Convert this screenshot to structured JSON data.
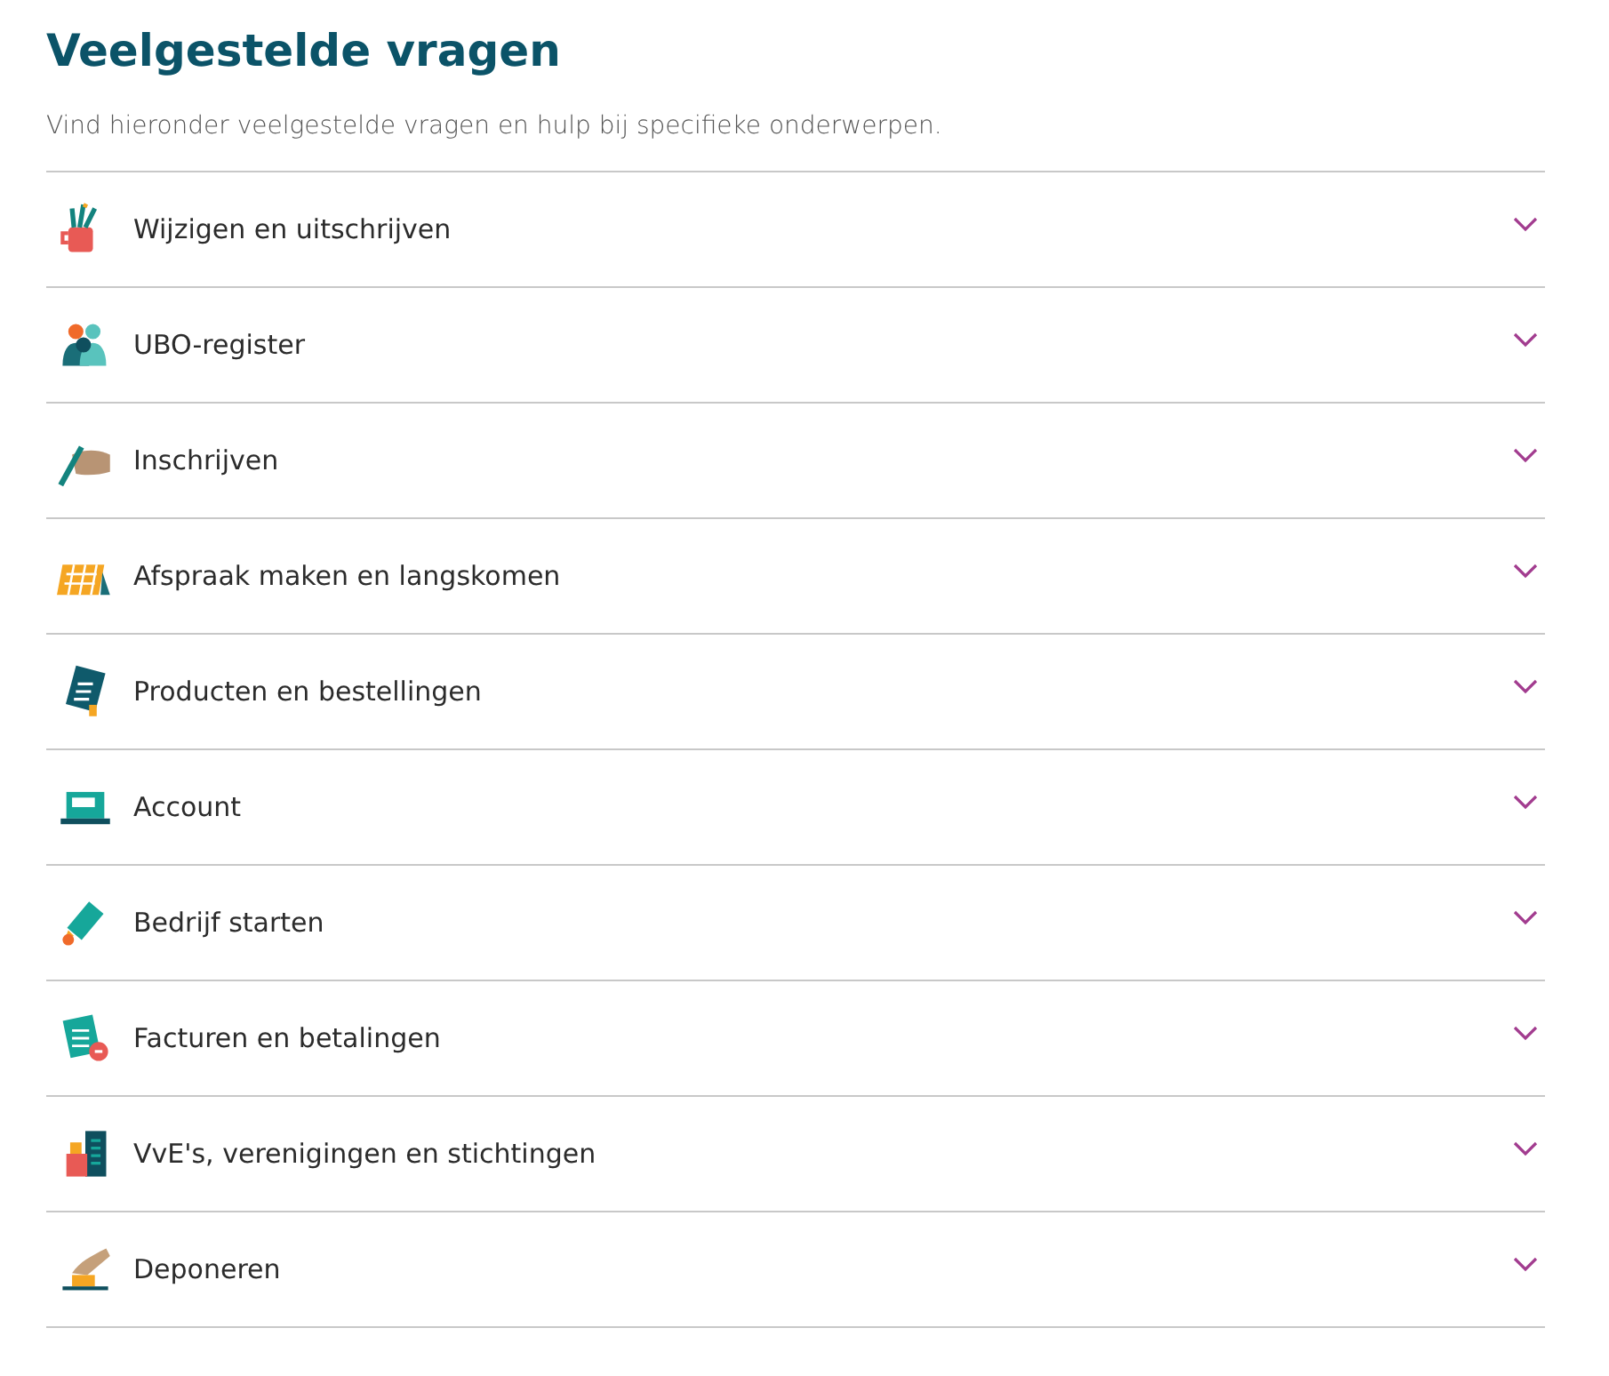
{
  "title": "Veelgestelde vragen",
  "intro": "Vind hieronder veelgestelde vragen en hulp bij specifieke onderwerpen.",
  "items": [
    {
      "label": "Wijzigen en uitschrijven",
      "expanded": false
    },
    {
      "label": "UBO-register",
      "expanded": false
    },
    {
      "label": "Inschrijven",
      "expanded": false
    },
    {
      "label": "Afspraak maken en langskomen",
      "expanded": false
    },
    {
      "label": "Producten en bestellingen",
      "expanded": false
    },
    {
      "label": "Account",
      "expanded": false
    },
    {
      "label": "Bedrijf starten",
      "expanded": false
    },
    {
      "label": "Facturen en betalingen",
      "expanded": false
    },
    {
      "label": "VvE's, verenigingen en stichtingen",
      "expanded": false
    },
    {
      "label": "Deponeren",
      "expanded": false
    }
  ]
}
